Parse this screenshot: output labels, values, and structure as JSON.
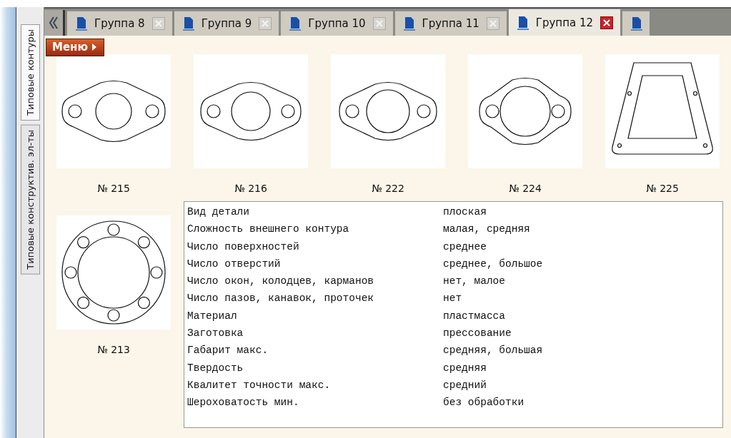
{
  "side_tabs": [
    {
      "label": "Типовые контуры",
      "selected": true
    },
    {
      "label": "Типовые конструктив. эл-ты",
      "selected": false
    }
  ],
  "tabs": [
    {
      "label": "Группа 8",
      "selected": false
    },
    {
      "label": "Группа 9",
      "selected": false
    },
    {
      "label": "Группа 10",
      "selected": false
    },
    {
      "label": "Группа 11",
      "selected": false
    },
    {
      "label": "Группа 12",
      "selected": true
    },
    {
      "selected": false
    }
  ],
  "menu_button": {
    "label": "Меню"
  },
  "parts": [
    {
      "label": "№ 215",
      "kind": "flange"
    },
    {
      "label": "№ 216",
      "kind": "flange"
    },
    {
      "label": "№ 222",
      "kind": "flange"
    },
    {
      "label": "№ 224",
      "kind": "flange"
    },
    {
      "label": "№ 225",
      "kind": "trapezoid"
    },
    {
      "label": "№ 213",
      "kind": "ring"
    }
  ],
  "properties": [
    {
      "name": "Вид детали",
      "value": "плоская"
    },
    {
      "name": "Сложность внешнего контура",
      "value": "малая, средняя"
    },
    {
      "name": "Число поверхностей",
      "value": "среднее"
    },
    {
      "name": "Число отверстий",
      "value": "среднее, большое"
    },
    {
      "name": "Число окон, колодцев, карманов",
      "value": "нет, малое"
    },
    {
      "name": "Число пазов, канавок, проточек",
      "value": "нет"
    },
    {
      "name": "Материал",
      "value": "пластмасса"
    },
    {
      "name": "Заготовка",
      "value": "прессование"
    },
    {
      "name": "Габарит макс.",
      "value": "средняя, большая"
    },
    {
      "name": "Твердость",
      "value": "средняя"
    },
    {
      "name": "Квалитет точности макс.",
      "value": "средний"
    },
    {
      "name": "Шероховатость мин.",
      "value": "без обработки"
    }
  ]
}
